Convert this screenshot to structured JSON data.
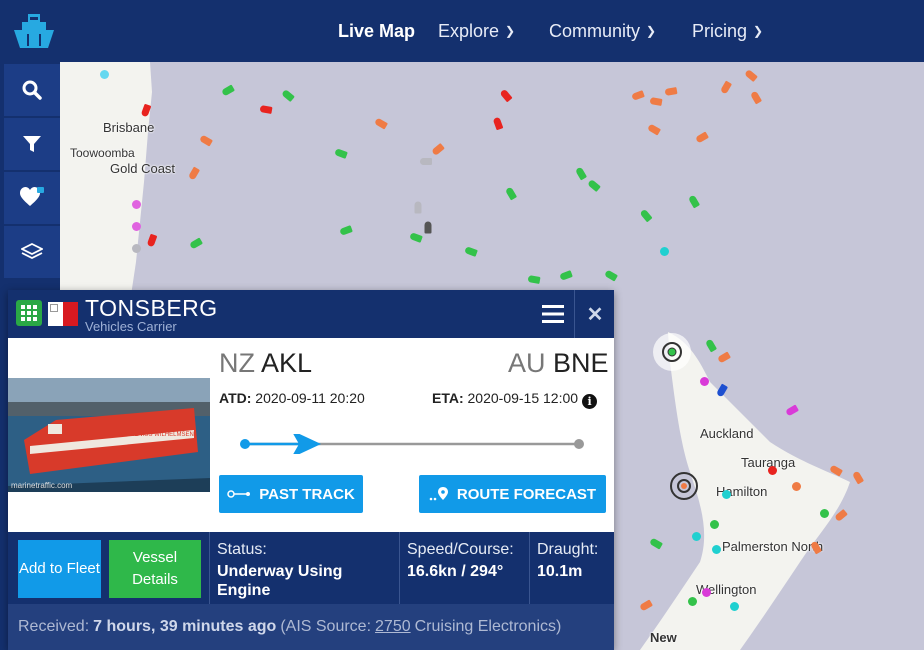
{
  "nav": {
    "live_map": "Live Map",
    "explore": "Explore",
    "community": "Community",
    "pricing": "Pricing"
  },
  "sidebar": {
    "icons": [
      "search-icon",
      "filter-icon",
      "heart-icon",
      "layers-icon"
    ]
  },
  "map": {
    "cities": {
      "brisbane": "Brisbane",
      "toowoomba": "Toowoomba",
      "gold_coast": "Gold Coast",
      "auckland": "Auckland",
      "tauranga": "Tauranga",
      "hamilton": "Hamilton",
      "palmerston_north": "Palmerston North",
      "wellington": "Wellington",
      "new": "New"
    }
  },
  "vessel": {
    "name": "TONSBERG",
    "type": "Vehicles Carrier",
    "photo_credit": "marinetraffic.com",
    "from_country": "NZ",
    "from_port": "AKL",
    "to_country": "AU",
    "to_port": "BNE",
    "atd_label": "ATD:",
    "atd_value": "2020-09-11 20:20",
    "eta_label": "ETA:",
    "eta_value": "2020-09-15 12:00",
    "past_track": "PAST TRACK",
    "route_forecast": "ROUTE FORECAST",
    "add_to_fleet": "Add to Fleet",
    "vessel_details": "Vessel Details",
    "status_label": "Status:",
    "status_value": "Underway Using Engine",
    "speed_label": "Speed/Course:",
    "speed_value": "16.6kn / 294°",
    "draught_label": "Draught:",
    "draught_value": "10.1m",
    "received_label": "Received:",
    "received_value": "7 hours, 39 minutes ago",
    "ais_prefix": "(AIS Source:",
    "ais_id": "2750",
    "ais_suffix": "Cruising Electronics)"
  },
  "colors": {
    "navy": "#14306e",
    "accent_blue": "#119ae8",
    "green": "#2fb84a"
  }
}
